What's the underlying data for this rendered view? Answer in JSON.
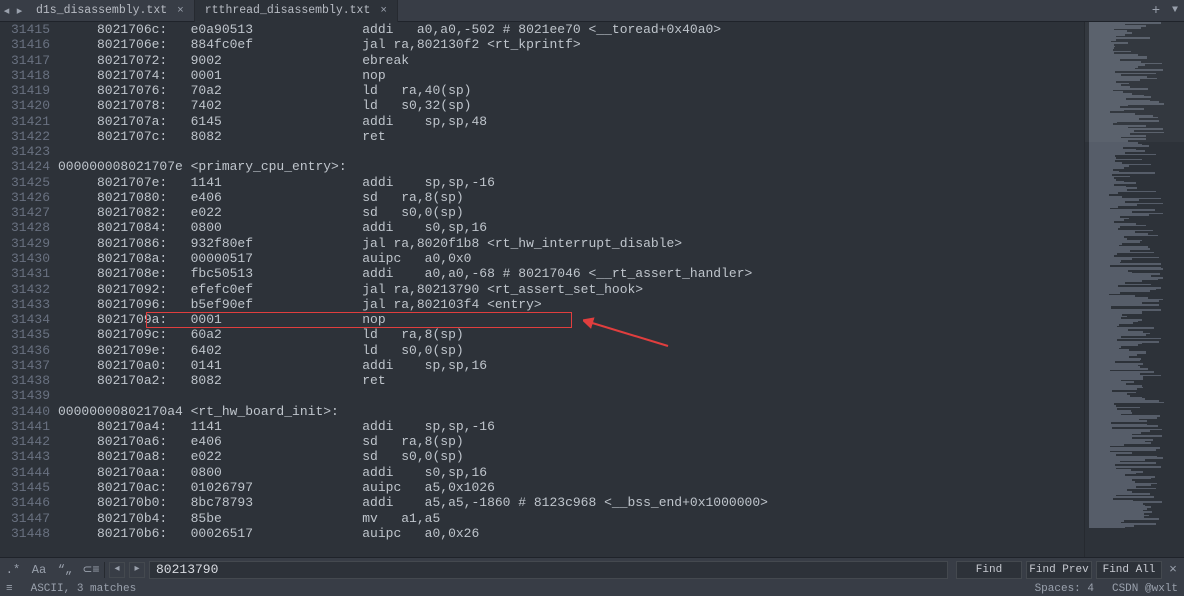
{
  "tabs": {
    "first": "d1s_disassembly.txt",
    "active": "rtthread_disassembly.txt"
  },
  "search": {
    "value": "80213790",
    "findLabel": "Find",
    "findPrevLabel": "Find Prev",
    "findAllLabel": "Find All"
  },
  "status": {
    "matches": "ASCII, 3 matches",
    "spaces": "Spaces: 4",
    "watermark": "CSDN @wxlt"
  },
  "gutterStart": 31415,
  "code": [
    "     8021706c:   e0a90513              addi   a0,a0,-502 # 8021ee70 <__toread+0x40a0>",
    "     8021706e:   884fc0ef              jal ra,802130f2 <rt_kprintf>",
    "     80217072:   9002                  ebreak",
    "     80217074:   0001                  nop",
    "     80217076:   70a2                  ld   ra,40(sp)",
    "     80217078:   7402                  ld   s0,32(sp)",
    "     8021707a:   6145                  addi    sp,sp,48",
    "     8021707c:   8082                  ret",
    "",
    "000000008021707e <primary_cpu_entry>:",
    "     8021707e:   1141                  addi    sp,sp,-16",
    "     80217080:   e406                  sd   ra,8(sp)",
    "     80217082:   e022                  sd   s0,0(sp)",
    "     80217084:   0800                  addi    s0,sp,16",
    "     80217086:   932f80ef              jal ra,8020f1b8 <rt_hw_interrupt_disable>",
    "     8021708a:   00000517              auipc   a0,0x0",
    "     8021708e:   fbc50513              addi    a0,a0,-68 # 80217046 <__rt_assert_handler>",
    "     80217092:   efefc0ef              jal ra,80213790 <rt_assert_set_hook>",
    "     80217096:   b5ef90ef              jal ra,802103f4 <entry>",
    "     8021709a:   0001                  nop",
    "     8021709c:   60a2                  ld   ra,8(sp)",
    "     8021709e:   6402                  ld   s0,0(sp)",
    "     802170a0:   0141                  addi    sp,sp,16",
    "     802170a2:   8082                  ret",
    "",
    "00000000802170a4 <rt_hw_board_init>:",
    "     802170a4:   1141                  addi    sp,sp,-16",
    "     802170a6:   e406                  sd   ra,8(sp)",
    "     802170a8:   e022                  sd   s0,0(sp)",
    "     802170aa:   0800                  addi    s0,sp,16",
    "     802170ac:   01026797              auipc   a5,0x1026",
    "     802170b0:   8bc78793              addi    a5,a5,-1860 # 8123c968 <__bss_end+0x1000000>",
    "     802170b4:   85be                  mv   a1,a5",
    "     802170b6:   00026517              auipc   a0,0x26"
  ]
}
